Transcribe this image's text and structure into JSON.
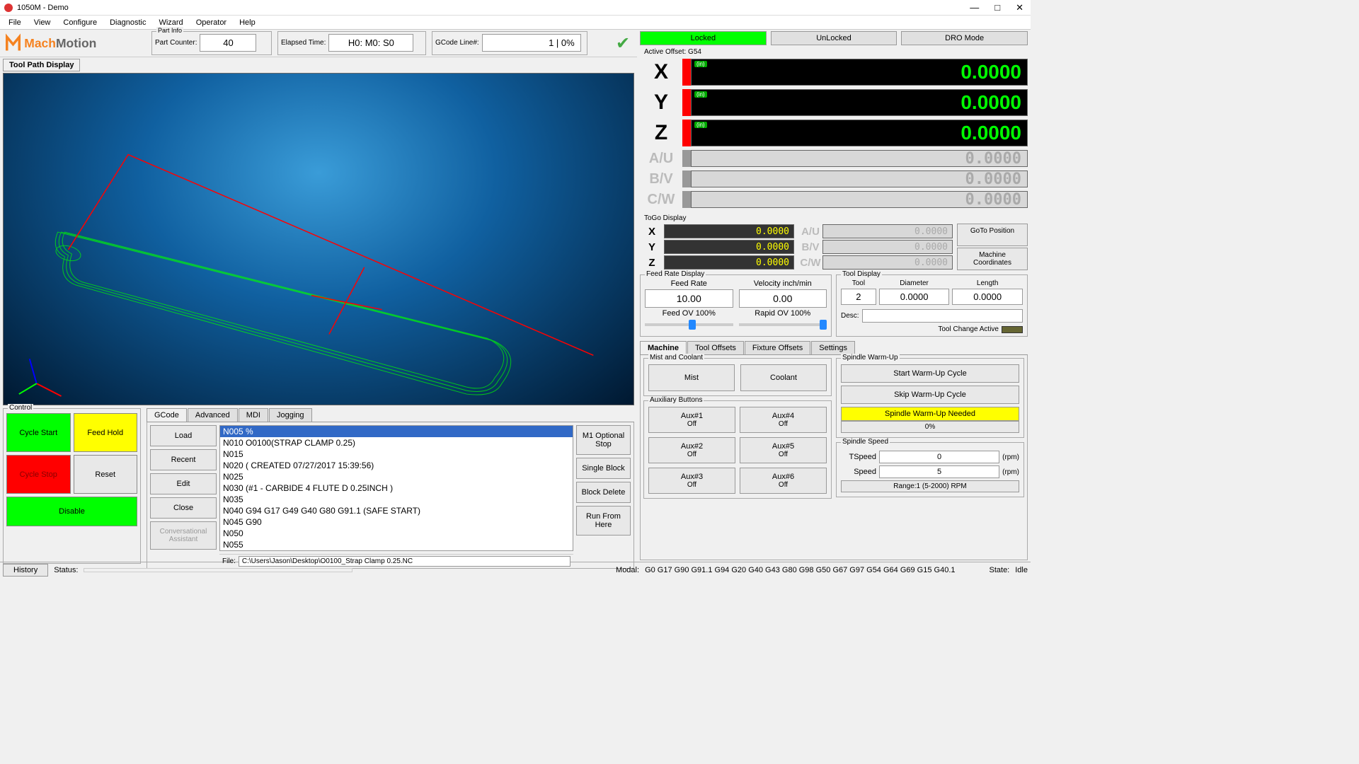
{
  "window": {
    "title": "1050M - Demo"
  },
  "menu": [
    "File",
    "View",
    "Configure",
    "Diagnostic",
    "Wizard",
    "Operator",
    "Help"
  ],
  "logo_text": "MachMotion",
  "topinfo": {
    "part_group": "Part Info",
    "part_label": "Part Counter:",
    "part_value": "40",
    "elapsed_label": "Elapsed Time:",
    "elapsed_value": "H0: M0: S0",
    "gcode_label": "GCode Line#:",
    "gcode_value": "1 | 0%"
  },
  "toolpath_label": "Tool Path Display",
  "control": {
    "label": "Control",
    "cycle_start": "Cycle Start",
    "feed_hold": "Feed Hold",
    "cycle_stop": "Cycle Stop",
    "reset": "Reset",
    "disable": "Disable"
  },
  "gcode": {
    "tabs": [
      "GCode",
      "Advanced",
      "MDI",
      "Jogging"
    ],
    "buttons": [
      "Load",
      "Recent",
      "Edit",
      "Close",
      "Conversational Assistant"
    ],
    "right_buttons": [
      "M1 Optional Stop",
      "Single Block",
      "Block Delete",
      "Run From Here"
    ],
    "lines": [
      "N005 %",
      "N010 O0100(STRAP CLAMP 0.25)",
      "N015",
      "N020 ( CREATED  07/27/2017 15:39:56)",
      "N025",
      "N030 (#1 - CARBIDE 4 FLUTE D 0.25INCH )",
      "N035",
      "N040 G94 G17 G49 G40 G80 G91.1 (SAFE START)",
      "N045 G90",
      "N050",
      "N055"
    ],
    "file_label": "File:",
    "file_path": "C:\\Users\\Jason\\Desktop\\O0100_Strap Clamp 0.25.NC"
  },
  "modes": {
    "locked": "Locked",
    "unlocked": "UnLocked",
    "dro": "DRO Mode"
  },
  "active_offset": "Active Offset: G54",
  "dro": [
    {
      "axis": "X",
      "value": "0.0000",
      "active": true
    },
    {
      "axis": "Y",
      "value": "0.0000",
      "active": true
    },
    {
      "axis": "Z",
      "value": "0.0000",
      "active": true
    },
    {
      "axis": "A/U",
      "value": "0.0000",
      "active": false
    },
    {
      "axis": "B/V",
      "value": "0.0000",
      "active": false
    },
    {
      "axis": "C/W",
      "value": "0.0000",
      "active": false
    }
  ],
  "togo": {
    "label": "ToGo Display",
    "left": [
      {
        "axis": "X",
        "value": "0.0000"
      },
      {
        "axis": "Y",
        "value": "0.0000"
      },
      {
        "axis": "Z",
        "value": "0.0000"
      }
    ],
    "right": [
      {
        "axis": "A/U",
        "value": "0.0000"
      },
      {
        "axis": "B/V",
        "value": "0.0000"
      },
      {
        "axis": "C/W",
        "value": "0.0000"
      }
    ],
    "goto_btn": "GoTo Position",
    "coord_btn": "Machine Coordinates"
  },
  "feed": {
    "title": "Feed Rate Display",
    "rate_label": "Feed Rate",
    "rate_value": "10.00",
    "vel_label": "Velocity inch/min",
    "vel_value": "0.00",
    "feed_ov": "Feed OV 100%",
    "rapid_ov": "Rapid OV 100%"
  },
  "tool": {
    "title": "Tool Display",
    "tool_label": "Tool",
    "tool_value": "2",
    "diam_label": "Diameter",
    "diam_value": "0.0000",
    "len_label": "Length",
    "len_value": "0.0000",
    "desc_label": "Desc:",
    "change_label": "Tool Change Active"
  },
  "bottom_tabs": [
    "Machine",
    "Tool Offsets",
    "Fixture Offsets",
    "Settings"
  ],
  "mist": {
    "title": "Mist and Coolant",
    "mist": "Mist",
    "coolant": "Coolant"
  },
  "aux": {
    "title": "Auxiliary Buttons",
    "buttons": [
      {
        "name": "Aux#1",
        "state": "Off"
      },
      {
        "name": "Aux#4",
        "state": "Off"
      },
      {
        "name": "Aux#2",
        "state": "Off"
      },
      {
        "name": "Aux#5",
        "state": "Off"
      },
      {
        "name": "Aux#3",
        "state": "Off"
      },
      {
        "name": "Aux#6",
        "state": "Off"
      }
    ]
  },
  "warmup": {
    "title": "Spindle Warm-Up",
    "start": "Start Warm-Up Cycle",
    "skip": "Skip Warm-Up Cycle",
    "banner": "Spindle Warm-Up Needed",
    "pct": "0%"
  },
  "spindle": {
    "title": "Spindle Speed",
    "tspeed_label": "TSpeed",
    "tspeed_value": "0",
    "speed_label": "Speed",
    "speed_value": "5",
    "unit": "(rpm)",
    "range": "Range:1 (5-2000) RPM"
  },
  "statusbar": {
    "history": "History",
    "status_label": "Status:",
    "status_value": "",
    "modal_label": "Modal:",
    "modal_value": "G0 G17 G90 G91.1 G94 G20 G40 G43 G80 G98 G50 G67 G97 G54 G64 G69 G15 G40.1",
    "state_label": "State:",
    "state_value": "Idle"
  }
}
